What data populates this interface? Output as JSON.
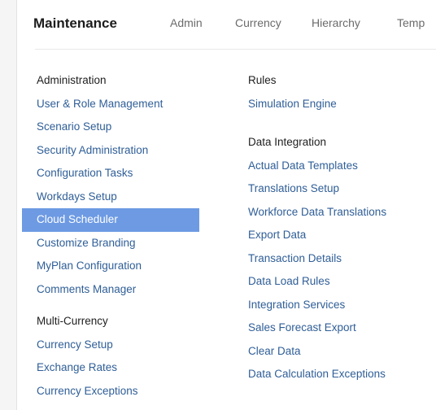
{
  "header": {
    "brand": "Maintenance",
    "tabs": [
      "Admin",
      "Currency",
      "Hierarchy",
      "Temp"
    ]
  },
  "colors": {
    "link": "#2f5e97",
    "selected_bg": "#6d9ae3",
    "heading": "#1e1e1e"
  },
  "left": {
    "administration": {
      "title": "Administration",
      "items": [
        "User & Role Management",
        "Scenario Setup",
        "Security Administration",
        "Configuration Tasks",
        "Workdays Setup",
        "Cloud Scheduler",
        "Customize Branding",
        "MyPlan Configuration",
        "Comments Manager"
      ],
      "selected": "Cloud Scheduler"
    },
    "multi_currency": {
      "title": "Multi-Currency",
      "items": [
        "Currency Setup",
        "Exchange Rates",
        "Currency Exceptions"
      ]
    }
  },
  "right": {
    "rules": {
      "title": "Rules",
      "items": [
        "Simulation Engine"
      ]
    },
    "data_integration": {
      "title": "Data Integration",
      "items": [
        "Actual Data Templates",
        "Translations Setup",
        "Workforce Data Translations",
        "Export Data",
        "Transaction Details",
        "Data Load Rules",
        "Integration Services",
        "Sales Forecast Export",
        "Clear Data",
        "Data Calculation Exceptions"
      ]
    }
  }
}
